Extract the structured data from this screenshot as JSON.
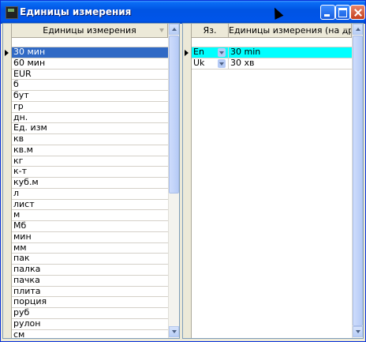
{
  "window": {
    "title": "Единицы измерения"
  },
  "left_grid": {
    "column_header": "Единицы измерения",
    "rows": [
      "30 мин",
      "60 мин",
      "EUR",
      "б",
      "бут",
      "гр",
      "дн.",
      "Ед. изм",
      "кв",
      "кв.м",
      "кг",
      "к-т",
      "куб.м",
      "л",
      "лист",
      "м",
      "Мб",
      "мин",
      "мм",
      "пак",
      "палка",
      "пачка",
      "плита",
      "порция",
      "руб",
      "рулон",
      "см"
    ]
  },
  "right_grid": {
    "columns": {
      "lang": "Яз.",
      "name": "Единицы измерения (на др. яз.)"
    },
    "rows": [
      {
        "lang": "En",
        "name": "30 min"
      },
      {
        "lang": "Uk",
        "name": "30 хв"
      }
    ]
  },
  "colors": {
    "selected_row": "#316ac5",
    "active_row": "#00ffff",
    "title_bar": "#0054e3"
  }
}
